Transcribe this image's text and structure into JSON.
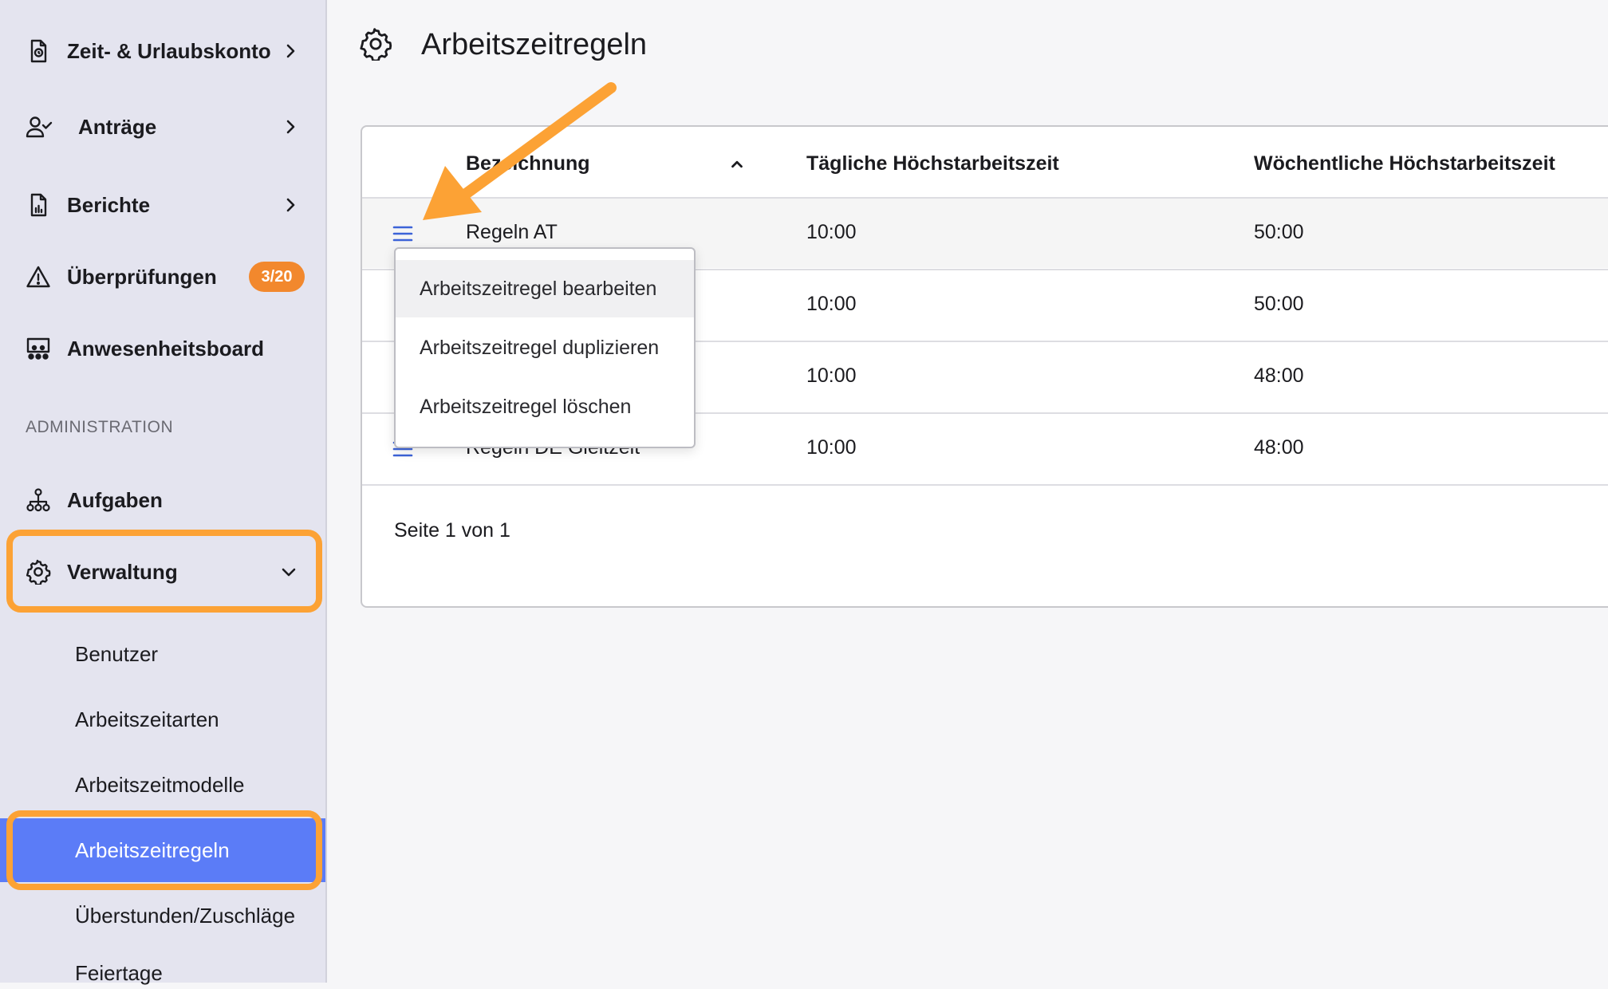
{
  "sidebar": {
    "items": [
      {
        "label": "Zeit- & Urlaubskonto",
        "icon": "document-clock-icon"
      },
      {
        "label": "Anträge",
        "icon": "user-check-icon"
      },
      {
        "label": "Berichte",
        "icon": "report-chart-icon"
      },
      {
        "label": "Überprüfungen",
        "icon": "warning-triangle-icon",
        "badge": "3/20"
      },
      {
        "label": "Anwesenheitsboard",
        "icon": "presence-board-icon"
      }
    ],
    "section_title": "ADMINISTRATION",
    "admin_items": [
      {
        "label": "Aufgaben",
        "icon": "org-tree-icon"
      },
      {
        "label": "Verwaltung",
        "icon": "gear-icon",
        "expanded": true
      }
    ],
    "sub_items": [
      {
        "label": "Benutzer"
      },
      {
        "label": "Arbeitszeitarten"
      },
      {
        "label": "Arbeitszeitmodelle"
      },
      {
        "label": "Arbeitszeitregeln",
        "active": true
      },
      {
        "label": "Überstunden/Zuschläge"
      },
      {
        "label": "Feiertage"
      }
    ]
  },
  "page": {
    "title": "Arbeitszeitregeln",
    "icon": "gear-icon"
  },
  "table": {
    "columns": [
      "Bezeichnung",
      "Tägliche Höchstarbeitszeit",
      "Wöchentliche Höchstarbeitszeit"
    ],
    "sort_column": "Bezeichnung",
    "sort_direction": "ascending",
    "rows": [
      {
        "name": "Regeln AT",
        "daily": "10:00",
        "weekly": "50:00"
      },
      {
        "name": "",
        "daily": "10:00",
        "weekly": "50:00"
      },
      {
        "name": "",
        "daily": "10:00",
        "weekly": "48:00"
      },
      {
        "name": "Regeln DE Gleitzeit",
        "daily": "10:00",
        "weekly": "48:00"
      }
    ],
    "pagination": "Seite 1 von 1"
  },
  "context_menu": {
    "items": [
      "Arbeitszeitregel bearbeiten",
      "Arbeitszeitregel duplizieren",
      "Arbeitszeitregel löschen"
    ]
  },
  "colors": {
    "sidebar_bg": "#e4e4ef",
    "active_item": "#5b7cf7",
    "badge": "#f2882d",
    "highlight": "#fca235",
    "menu_icon": "#3c63d8"
  }
}
